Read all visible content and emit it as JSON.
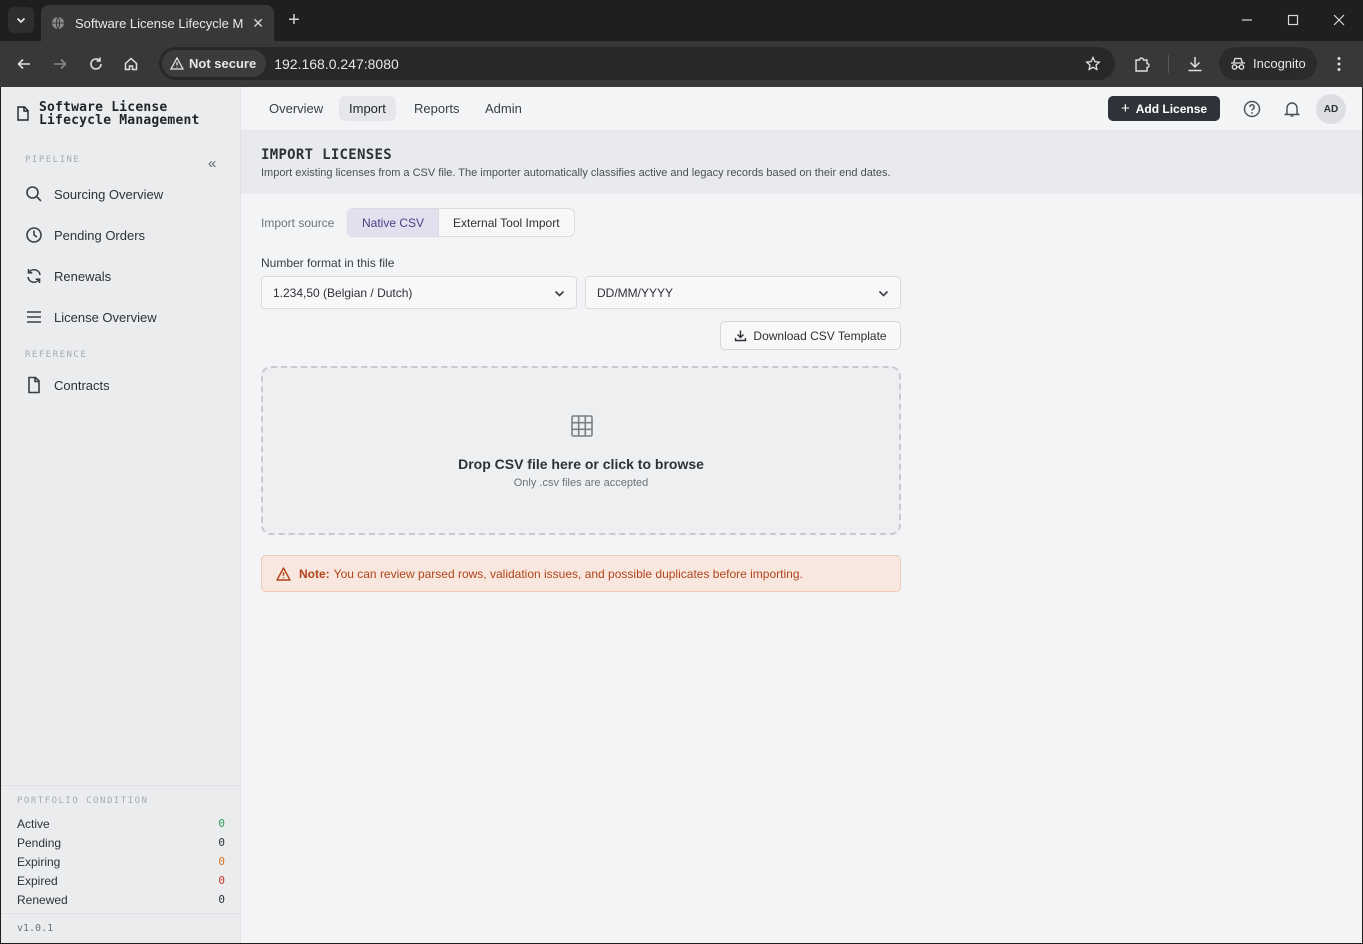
{
  "browser": {
    "tab_title": "Software License Lifecycle Management",
    "new_tab": "+",
    "security_label": "Not secure",
    "url": "192.168.0.247:8080",
    "incognito_label": "Incognito"
  },
  "sidebar": {
    "brand_line1": "Software License",
    "brand_line2": "Lifecycle Management",
    "collapse": "«",
    "pipeline_label": "PIPELINE",
    "pipeline_items": [
      {
        "label": "Sourcing Overview",
        "icon": "search-icon"
      },
      {
        "label": "Pending Orders",
        "icon": "clock-icon"
      },
      {
        "label": "Renewals",
        "icon": "refresh-icon"
      },
      {
        "label": "License Overview",
        "icon": "list-icon"
      }
    ],
    "reference_label": "REFERENCE",
    "reference_items": [
      {
        "label": "Contracts",
        "icon": "file-icon"
      }
    ],
    "portfolio": {
      "title": "PORTFOLIO CONDITION",
      "rows": [
        {
          "label": "Active",
          "value": "0",
          "color": "#2e9c5a"
        },
        {
          "label": "Pending",
          "value": "0",
          "color": "#2d3138"
        },
        {
          "label": "Expiring",
          "value": "0",
          "color": "#d9731e"
        },
        {
          "label": "Expired",
          "value": "0",
          "color": "#c9372c"
        },
        {
          "label": "Renewed",
          "value": "0",
          "color": "#2d3138"
        }
      ]
    },
    "version": "v1.0.1"
  },
  "topnav": {
    "tabs": [
      "Overview",
      "Import",
      "Reports",
      "Admin"
    ],
    "active_tab": "Import",
    "add_license_plus": "+",
    "add_license": "Add License",
    "avatar": "AD"
  },
  "page": {
    "title": "IMPORT LICENSES",
    "description": "Import existing licenses from a CSV file. The importer automatically classifies active and legacy records based on their end dates.",
    "import_source_label": "Import source",
    "sources": [
      "Native CSV",
      "External Tool Import"
    ],
    "active_source": "Native CSV",
    "number_format_label": "Number format in this file",
    "number_format_value": "1.234,50 (Belgian / Dutch)",
    "date_format_value": "DD/MM/YYYY",
    "download_template": "Download CSV Template",
    "dropzone_title": "Drop CSV file here or click to browse",
    "dropzone_sub": "Only .csv files are accepted",
    "note_label": "Note:",
    "note_text": "You can review parsed rows, validation issues, and possible duplicates before importing."
  },
  "colors": {
    "accent": "#4a3f86",
    "primary_button": "#2f3339",
    "note_text": "#b2441b"
  }
}
